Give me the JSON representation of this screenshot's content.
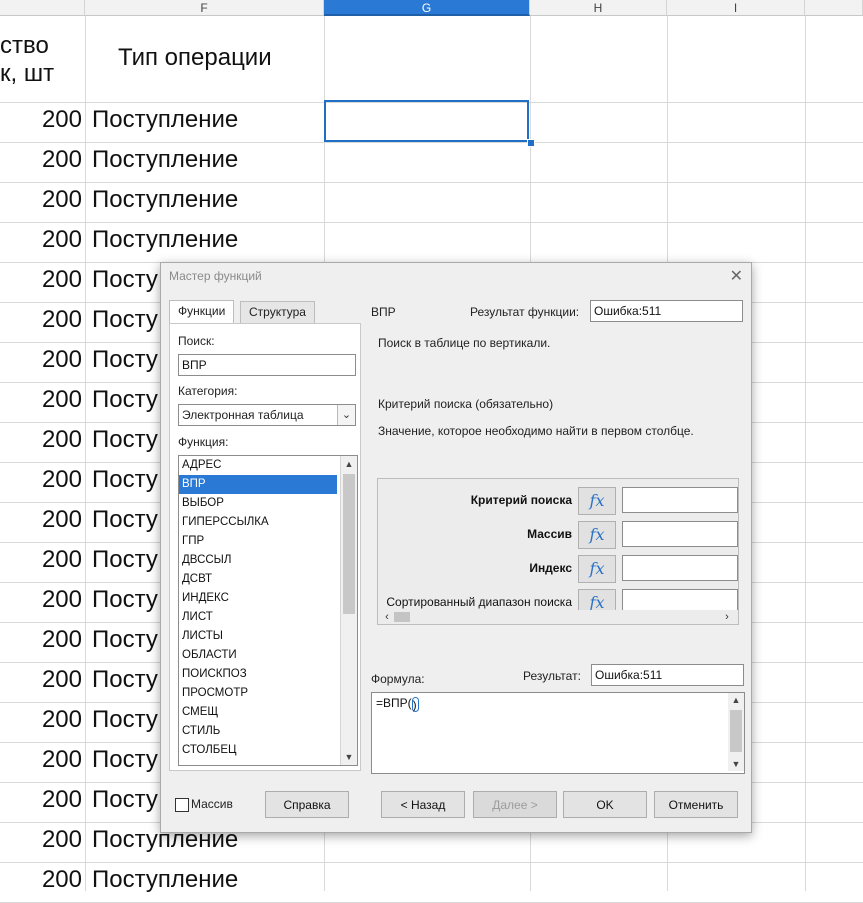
{
  "sheet": {
    "columns": [
      {
        "label": "",
        "sel": false
      },
      {
        "label": "F",
        "sel": false
      },
      {
        "label": "G",
        "sel": true
      },
      {
        "label": "H",
        "sel": false
      },
      {
        "label": "I",
        "sel": false
      }
    ],
    "header_e_line1": "ство",
    "header_e_line2": "к, шт",
    "header_f": "Тип операции",
    "row_value": "200",
    "row_text_full": "Поступление",
    "row_text_clipped": "Посту"
  },
  "dialog": {
    "title": "Мастер функций",
    "close_glyph": "✕",
    "tabs": [
      "Функции",
      "Структура"
    ],
    "search_label": "Поиск:",
    "search_value": "ВПР",
    "category_label": "Категория:",
    "category_value": "Электронная таблица",
    "function_label": "Функция:",
    "functions": [
      "АДРЕС",
      "ВПР",
      "ВЫБОР",
      "ГИПЕРССЫЛКА",
      "ГПР",
      "ДВССЫЛ",
      "ДСВТ",
      "ИНДЕКС",
      "ЛИСТ",
      "ЛИСТЫ",
      "ОБЛАСТИ",
      "ПОИСКПОЗ",
      "ПРОСМОТР",
      "СМЕЩ",
      "СТИЛЬ",
      "СТОЛБЕЦ"
    ],
    "selected_function": "ВПР",
    "func_name": "ВПР",
    "func_result_label": "Результат функции:",
    "func_result_value": "Ошибка:511",
    "func_description": "Поиск в таблице по вертикали.",
    "arg_title": "Критерий поиска (обязательно)",
    "arg_description": "Значение, которое необходимо найти в первом столбце.",
    "args": [
      {
        "label": "Критерий поиска",
        "bold": true
      },
      {
        "label": "Массив",
        "bold": true
      },
      {
        "label": "Индекс",
        "bold": true
      },
      {
        "label": "Сортированный диапазон поиска",
        "bold": false
      }
    ],
    "fx_glyph": "fx",
    "formula_label": "Формула:",
    "result_label": "Результат:",
    "result_value": "Ошибка:511",
    "formula_text": "=ВПР(",
    "formula_close": ")",
    "array_label": "Массив",
    "buttons": {
      "help": "Справка",
      "back": "< Назад",
      "next": "Далее >",
      "ok": "OK",
      "cancel": "Отменить"
    }
  },
  "icons": {
    "scroll_up": "▲",
    "scroll_down": "▼",
    "scroll_left": "‹",
    "scroll_right": "›",
    "combo_arrow": "⌄"
  }
}
